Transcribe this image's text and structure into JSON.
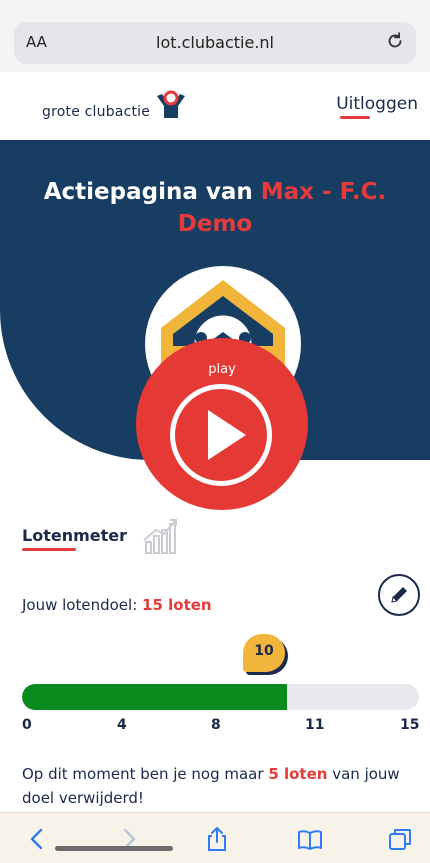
{
  "browser": {
    "text_size_label": "AA",
    "url": "lot.clubactie.nl"
  },
  "header": {
    "logo_text": "grote clubactie",
    "logout_label": "Uitloggen"
  },
  "hero": {
    "title_prefix": "Actiepagina van ",
    "title_highlight": "Max - F.C. Demo"
  },
  "video": {
    "play_label": "play"
  },
  "lotenmeter": {
    "title": "Lotenmeter",
    "goal_label": "Jouw lotendoel: ",
    "goal_value": "15 loten",
    "current_value": "10",
    "progress_current": 10,
    "progress_max": 15,
    "ticks": [
      "0",
      "4",
      "8",
      "11",
      "15"
    ],
    "message_prefix": "Op dit moment ben je nog maar ",
    "message_highlight": "5 loten",
    "message_suffix": " van jouw doel verwijderd!"
  },
  "colors": {
    "navy": "#173d63",
    "accent_red": "#e63b3b",
    "progress_green": "#0b8a1e",
    "marker_yellow": "#f0b53a"
  },
  "icons": {
    "reload": "reload-icon",
    "logo": "clubactie-logo-icon",
    "badge": "football-badge-icon",
    "play": "play-icon",
    "chart": "chart-icon",
    "edit": "pencil-icon",
    "back": "back-icon",
    "forward": "forward-icon",
    "share": "share-icon",
    "bookmarks": "bookmarks-icon",
    "tabs": "tabs-icon"
  }
}
